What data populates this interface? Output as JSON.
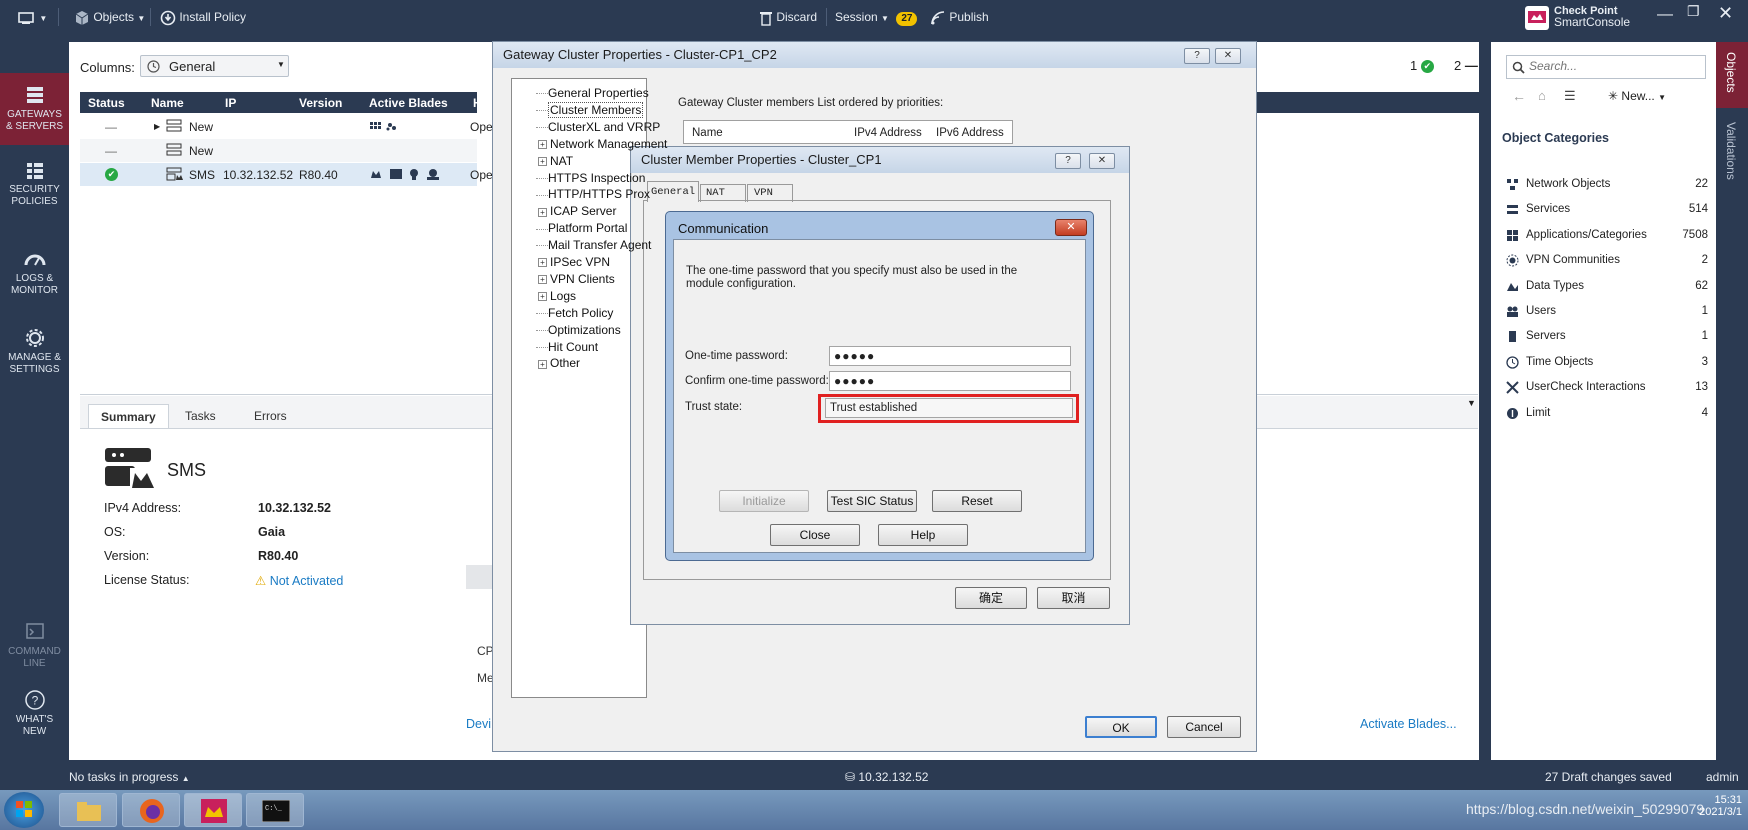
{
  "topbar": {
    "objects_label": "Objects",
    "install_policy_label": "Install Policy",
    "discard_label": "Discard",
    "session_label": "Session",
    "session_count": "27",
    "publish_label": "Publish",
    "brand_line1": "Check Point",
    "brand_line2": "SmartConsole"
  },
  "leftnav": {
    "items": [
      {
        "line1": "GATEWAYS",
        "line2": "& SERVERS"
      },
      {
        "line1": "SECURITY",
        "line2": "POLICIES"
      },
      {
        "line1": "LOGS &",
        "line2": "MONITOR"
      },
      {
        "line1": "MANAGE &",
        "line2": "SETTINGS"
      },
      {
        "line1": "COMMAND",
        "line2": "LINE"
      },
      {
        "line1": "WHAT'S",
        "line2": "NEW"
      }
    ]
  },
  "grid": {
    "columns_label": "Columns:",
    "columns_value": "General",
    "headers": {
      "status": "Status",
      "name": "Name",
      "ip": "IP",
      "version": "Version",
      "active_blades": "Active Blades",
      "hardware": "Har"
    },
    "rows": [
      {
        "status": "—",
        "name": "New",
        "ip": "",
        "version": "",
        "hw": "Ope"
      },
      {
        "status": "—",
        "name": "New",
        "ip": "",
        "version": "",
        "hw": ""
      },
      {
        "status": "ok",
        "name": "SMS",
        "ip": "10.32.132.52",
        "version": "R80.40",
        "hw": "Ope"
      }
    ],
    "count_ok": "1",
    "count_other": "2"
  },
  "details": {
    "tabs": [
      "Summary",
      "Tasks",
      "Errors"
    ],
    "title": "SMS",
    "ipv4_label": "IPv4 Address:",
    "ipv4_value": "10.32.132.52",
    "os_label": "OS:",
    "os_value": "Gaia",
    "version_label": "Version:",
    "version_value": "R80.40",
    "license_label": "License Status:",
    "license_value": "Not Activated",
    "partial_cp": "CP",
    "partial_me": "Me",
    "partial_devi": "Devi",
    "activate_link": "Activate Blades..."
  },
  "right": {
    "search_placeholder": "Search...",
    "new_label": "New...",
    "categories_title": "Object Categories",
    "categories": [
      {
        "label": "Network Objects",
        "count": "22"
      },
      {
        "label": "Services",
        "count": "514"
      },
      {
        "label": "Applications/Categories",
        "count": "7508"
      },
      {
        "label": "VPN Communities",
        "count": "2"
      },
      {
        "label": "Data Types",
        "count": "62"
      },
      {
        "label": "Users",
        "count": "1"
      },
      {
        "label": "Servers",
        "count": "1"
      },
      {
        "label": "Time Objects",
        "count": "3"
      },
      {
        "label": "UserCheck Interactions",
        "count": "13"
      },
      {
        "label": "Limit",
        "count": "4"
      }
    ],
    "side_tabs": [
      "Objects",
      "Validations"
    ]
  },
  "gw_dialog": {
    "title": "Gateway Cluster Properties - Cluster-CP1_CP2",
    "tree": [
      {
        "label": "General Properties",
        "expandable": false
      },
      {
        "label": "Cluster Members",
        "expandable": false
      },
      {
        "label": "ClusterXL and VRRP",
        "expandable": false
      },
      {
        "label": "Network Management",
        "expandable": true
      },
      {
        "label": "NAT",
        "expandable": true
      },
      {
        "label": "HTTPS Inspection",
        "expandable": false
      },
      {
        "label": "HTTP/HTTPS Prox",
        "expandable": false
      },
      {
        "label": "ICAP Server",
        "expandable": true
      },
      {
        "label": "Platform Portal",
        "expandable": false
      },
      {
        "label": "Mail Transfer Agent",
        "expandable": false
      },
      {
        "label": "IPSec VPN",
        "expandable": true
      },
      {
        "label": "VPN Clients",
        "expandable": true
      },
      {
        "label": "Logs",
        "expandable": true
      },
      {
        "label": "Fetch Policy",
        "expandable": false
      },
      {
        "label": "Optimizations",
        "expandable": false
      },
      {
        "label": "Hit Count",
        "expandable": false
      },
      {
        "label": "Other",
        "expandable": true
      }
    ],
    "members_caption": "Gateway Cluster members List ordered by priorities:",
    "members_headers": [
      "Name",
      "IPv4 Address",
      "IPv6 Address"
    ],
    "ok_label": "OK",
    "cancel_label": "Cancel"
  },
  "member_dialog": {
    "title": "Cluster Member Properties - Cluster_CP1",
    "tabs": [
      "General",
      "NAT",
      "VPN"
    ],
    "ok_label": "确定",
    "cancel_label": "取消"
  },
  "comm_dialog": {
    "title": "Communication",
    "message": "The one-time password that you specify must also be used in the module configuration.",
    "otp_label": "One-time password:",
    "otp_value": "●●●●●",
    "confirm_label": "Confirm one-time password:",
    "confirm_value": "●●●●●",
    "trust_label": "Trust state:",
    "trust_value": "Trust established",
    "initialize_label": "Initialize",
    "test_label": "Test SIC Status",
    "reset_label": "Reset",
    "close_label": "Close",
    "help_label": "Help"
  },
  "status": {
    "tasks": "No tasks in progress",
    "server_ip": "10.32.132.52",
    "drafts": "27 Draft changes saved",
    "user": "admin"
  },
  "taskbar": {
    "watermark": "https://blog.csdn.net/weixin_50299079",
    "time": "15:31",
    "date": "2021/3/1"
  },
  "colors": {
    "accent": "#7c2236",
    "header": "#2b3a52",
    "link": "#1a7bc4",
    "highlight": "#e02020"
  }
}
